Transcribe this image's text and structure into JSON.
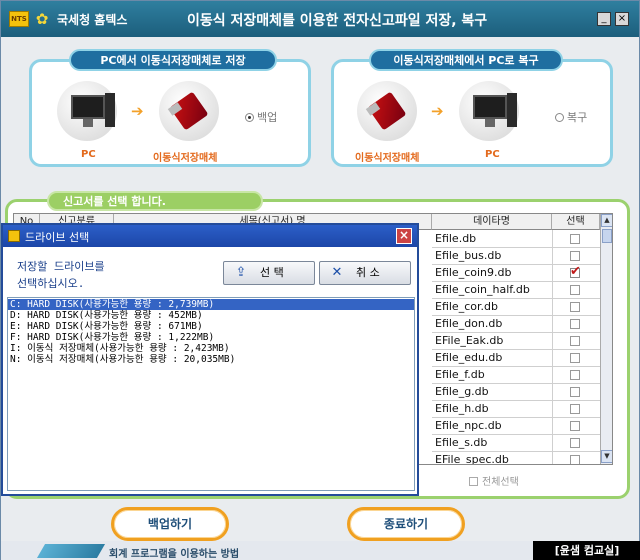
{
  "window": {
    "org_name": "국세청 홈텍스",
    "logo_text": "NTS",
    "title": "이동식 저장매체를 이용한 전자신고파일 저장, 복구",
    "minimize": "_",
    "close": "×"
  },
  "backup_panel": {
    "title": "PC에서 이동식저장매체로 저장",
    "source_label": "PC",
    "target_label": "이동식저장매체",
    "option_label": "백업",
    "selected": true
  },
  "restore_panel": {
    "title": "이동식저장매체에서 PC로 복구",
    "source_label": "이동식저장매체",
    "target_label": "PC",
    "option_label": "복구",
    "selected": false
  },
  "arrow_glyph": "➔",
  "file_list": {
    "title": "신고서를 선택 합니다.",
    "columns": {
      "no": "No",
      "type": "신고분류",
      "detail": "세목(신고서) 명",
      "data": "데이타명",
      "select": "선택"
    },
    "rows": [
      {
        "name": "Efile.db",
        "checked": false
      },
      {
        "name": "Efile_bus.db",
        "checked": false
      },
      {
        "name": "Efile_coin9.db",
        "checked": true
      },
      {
        "name": "Efile_coin_half.db",
        "checked": false
      },
      {
        "name": "Efile_cor.db",
        "checked": false
      },
      {
        "name": "Efile_don.db",
        "checked": false
      },
      {
        "name": "EFile_Eak.db",
        "checked": false
      },
      {
        "name": "Efile_edu.db",
        "checked": false
      },
      {
        "name": "Efile_f.db",
        "checked": false
      },
      {
        "name": "Efile_g.db",
        "checked": false
      },
      {
        "name": "Efile_h.db",
        "checked": false
      },
      {
        "name": "Efile_npc.db",
        "checked": false
      },
      {
        "name": "Efile_s.db",
        "checked": false
      },
      {
        "name": "EFile_spec.db",
        "checked": false
      }
    ],
    "select_all": "전체선택"
  },
  "buttons": {
    "backup": "백업하기",
    "exit": "종료하기"
  },
  "footer": {
    "text": "회계 프로그램을 이용하는 방법",
    "watermark": "[윤샘 컴교실]"
  },
  "dialog": {
    "title": "드라이브 선택",
    "close": "×",
    "message_line1": "저장할 드라이브를",
    "message_line2": "선택하십시오.",
    "select_button": "선 택",
    "select_icon": "⇪",
    "cancel_button": "취 소",
    "cancel_icon": "✕",
    "drives": [
      "C: HARD DISK(사용가능한 용량 : 2,739MB)",
      "D: HARD DISK(사용가능한 용량 : 452MB)",
      "E: HARD DISK(사용가능한 용량 : 671MB)",
      "F: HARD DISK(사용가능한 용량 : 1,222MB)",
      "I: 이동식 저장매체(사용가능한 용량 : 2,423MB)",
      "N: 이동식 저장매체(사용가능한 용량 : 20,035MB)"
    ],
    "selected_index": 0
  },
  "colors": {
    "title_bar": "#1c5e7c",
    "panel_border": "#8fd2e6",
    "list_border": "#9bd16e",
    "button_border": "#f0a020",
    "dialog_selection": "#3464c4"
  }
}
